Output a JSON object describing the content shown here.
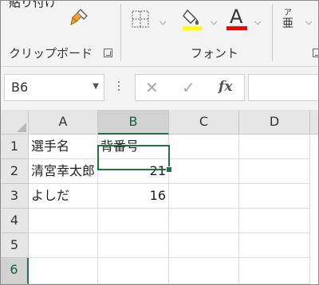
{
  "ribbon": {
    "top_text": "貼り付け",
    "groups": {
      "clipboard_label": "クリップボード",
      "font_label": "フォント"
    },
    "font_color_letter": "A",
    "phonetic_top": "ア",
    "phonetic_bottom": "亜",
    "highlight_color": "#ffff00",
    "font_color": "#ff0000",
    "icons": [
      "format-painter-icon",
      "borders-icon",
      "fill-color-icon",
      "font-color-icon",
      "phonetic-guide-icon"
    ]
  },
  "formula_bar": {
    "name_box": "B6",
    "cancel_glyph": "✕",
    "enter_glyph": "✓",
    "function_label": "fx",
    "formula": ""
  },
  "grid": {
    "columns": [
      "A",
      "B",
      "C",
      "D"
    ],
    "selected_column": "B",
    "rows": [
      "1",
      "2",
      "3",
      "4",
      "5",
      "6"
    ],
    "selected_row": "6",
    "accent_color": "#217346",
    "cells": {
      "A1": "選手名",
      "B1": "背番号",
      "A2": "清宮幸太郎",
      "B2": "21",
      "A3": "よしだ",
      "B3": "16"
    }
  }
}
